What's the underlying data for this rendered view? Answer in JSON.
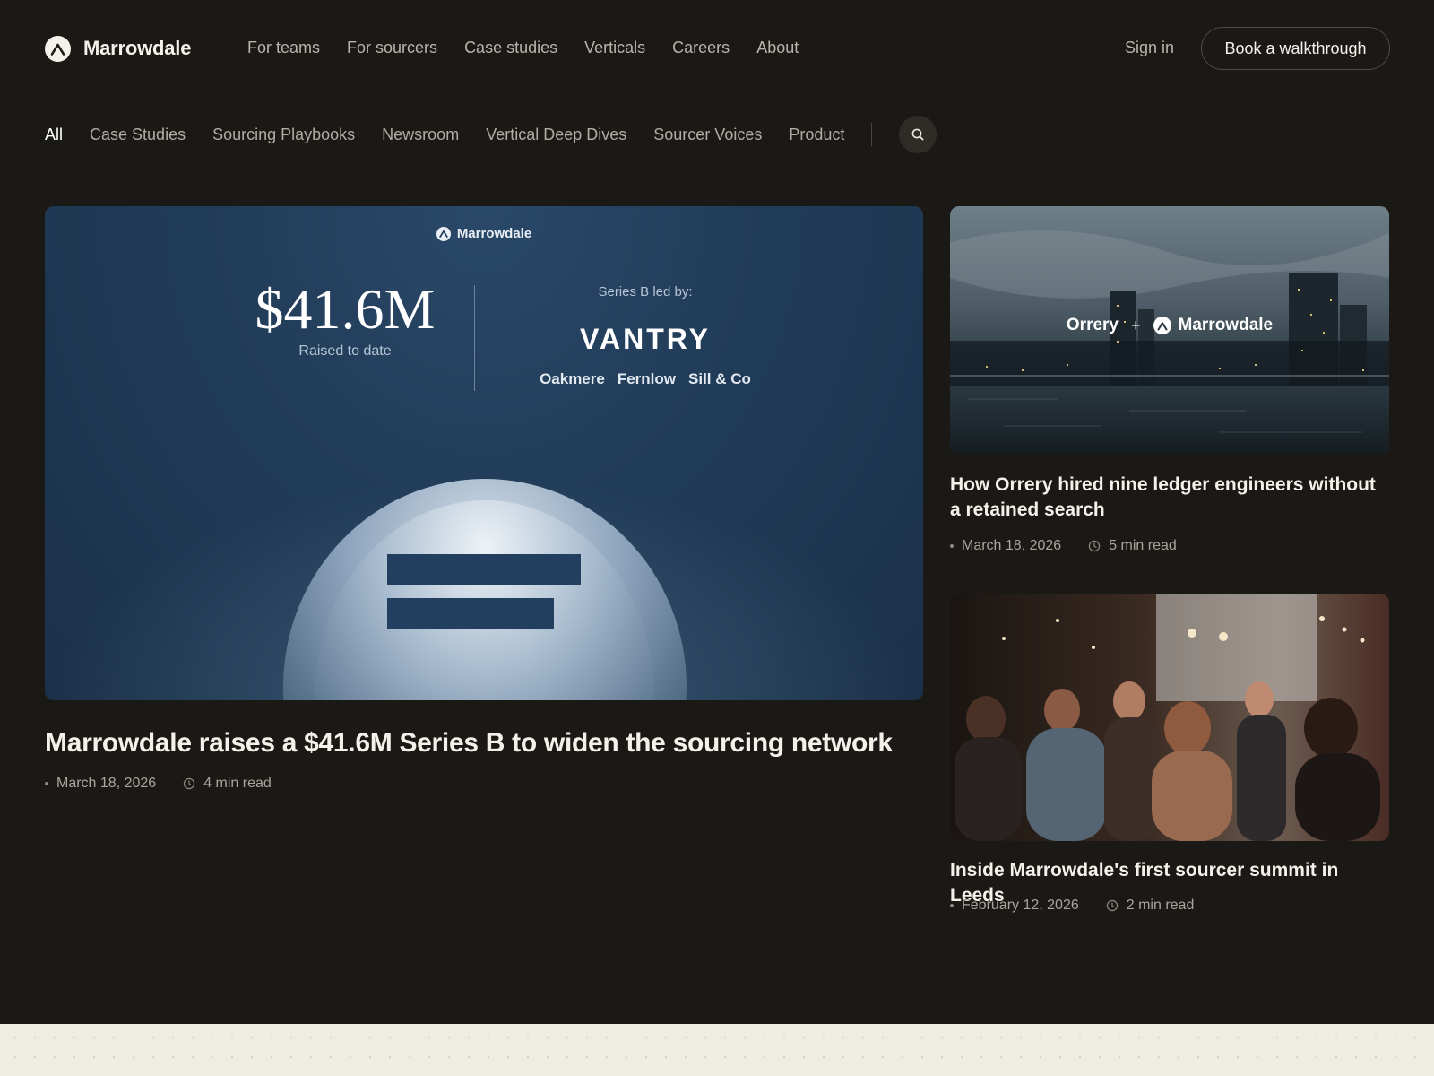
{
  "brand": {
    "name": "Marrowdale"
  },
  "nav": {
    "links": [
      "For teams",
      "For sourcers",
      "Case studies",
      "Verticals",
      "Careers",
      "About"
    ],
    "signin": "Sign in",
    "cta": "Book a walkthrough"
  },
  "filters": {
    "items": [
      "All",
      "Case Studies",
      "Sourcing Playbooks",
      "Newsroom",
      "Vertical Deep Dives",
      "Sourcer Voices",
      "Product"
    ],
    "active": "All",
    "search_icon": "search-icon"
  },
  "featured": {
    "image": {
      "logo_text": "Marrowdale",
      "amount": "$41.6M",
      "amount_label": "Raised to date",
      "led_label": "Series B led by:",
      "lead_investor": "VANTRY",
      "investors": [
        "Oakmere",
        "Fernlow",
        "Sill & Co"
      ]
    },
    "title": "Marrowdale raises a $41.6M Series B to widen the sourcing network",
    "date": "March 18, 2026",
    "read_time": "4 min read"
  },
  "cards": [
    {
      "image": {
        "partner": "Orrery",
        "plus": "+",
        "brand": "Marrowdale"
      },
      "title": "How Orrery hired nine ledger engineers without a retained search",
      "date": "March 18, 2026",
      "read_time": "5 min read"
    },
    {
      "title": "Inside Marrowdale's first sourcer summit in Leeds",
      "date": "February 12, 2026",
      "read_time": "2 min read"
    }
  ],
  "colors": {
    "background": "#1b1916",
    "hero_blue": "#213c58",
    "footer": "#efece3"
  }
}
